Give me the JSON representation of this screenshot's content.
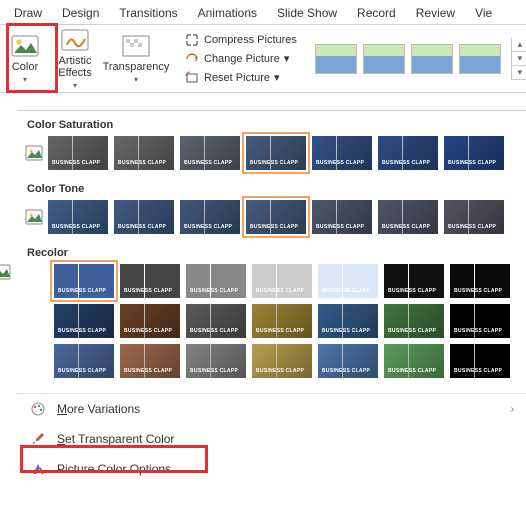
{
  "tabs": [
    "Draw",
    "Design",
    "Transitions",
    "Animations",
    "Slide Show",
    "Record",
    "Review",
    "Vie"
  ],
  "toolbar": {
    "color": "Color",
    "artistic": "Artistic\nEffects",
    "transparency": "Transparency",
    "compress": "Compress Pictures",
    "change": "Change Picture",
    "reset": "Reset Picture"
  },
  "sections": {
    "sat": "Color Saturation",
    "tone": "Color Tone",
    "recolor": "Recolor"
  },
  "menu": {
    "more": "More Variations",
    "set_trans": "Set Transparent Color",
    "opts": "Picture Color Options..."
  },
  "thumb_label": "BUSINESS CLAPP",
  "sat_colors": [
    "#777",
    "#7a7a78",
    "#6d7482",
    "#516c94",
    "#3e5f9c",
    "#35599e",
    "#2d52a0"
  ],
  "tone_colors": [
    "#4a6ea3",
    "#4b6a9a",
    "#4c6790",
    "#516c94",
    "#5a6680",
    "#5f6378",
    "#646170"
  ],
  "recolor_rows": [
    [
      "#3e5f9c",
      "#444",
      "#888",
      "#ccc",
      "#dbe7f5",
      "#111",
      "#0a0a0a"
    ],
    [
      "#2a4a7a",
      "#7a4a2a",
      "#6a6a6a",
      "#b89a3a",
      "#3a6aa0",
      "#4a8a4a",
      "#000"
    ],
    [
      "#5a7aba",
      "#ba7a5a",
      "#9a9a9a",
      "#d8ba5a",
      "#5a8aca",
      "#6aba6a",
      "#000"
    ]
  ],
  "sat_selected": 3,
  "tone_selected": 3,
  "recolor_selected": 0
}
